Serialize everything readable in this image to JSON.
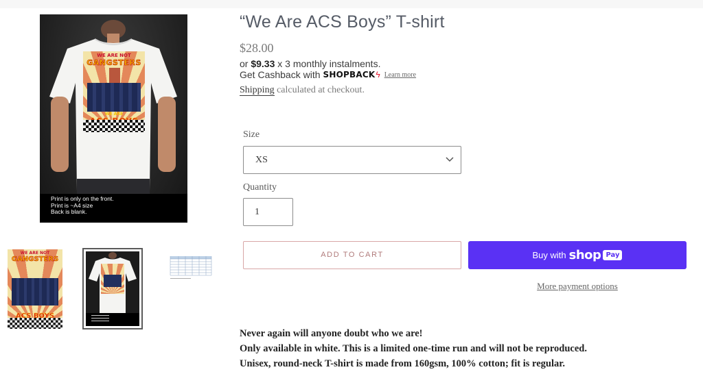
{
  "product": {
    "title": "“We Are ACS Boys” T-shirt",
    "price": "$28.00",
    "installment_prefix": "or ",
    "installment_amount": "$9.33",
    "installment_suffix": " x 3 monthly instalments.",
    "cashback_text": "Get Cashback with",
    "cashback_brand": "SHOPBACK",
    "learn_more": "Learn more",
    "shipping_link": "Shipping",
    "shipping_text": " calculated at checkout."
  },
  "images": {
    "main_caption": [
      "Print is only on the front.",
      "Print is ~A4 size",
      "Back is blank."
    ],
    "art_text": {
      "line1": "WE ARE NOT",
      "line2": "GANGSTERS",
      "line3": "WE ARE",
      "line4": "ACS BOYS"
    },
    "thumbnails": [
      "design-artwork",
      "tshirt-photo",
      "size-chart"
    ]
  },
  "form": {
    "size_label": "Size",
    "size_value": "XS",
    "quantity_label": "Quantity",
    "quantity_value": "1"
  },
  "actions": {
    "add_to_cart": "ADD TO CART",
    "buy_with": "Buy with",
    "shop_brand": "shop",
    "pay_badge": "Pay",
    "more_options": "More payment options"
  },
  "description": [
    "Never again will anyone doubt who we are!",
    "Only available in white. This is a limited one-time run and will not be reproduced.",
    "Unisex, round-neck T-shirt is made from 160gsm, 100% cotton; fit is regular."
  ],
  "colors": {
    "shop_pay": "#5a31f4",
    "add_to_cart_border": "#d8a6a6"
  }
}
